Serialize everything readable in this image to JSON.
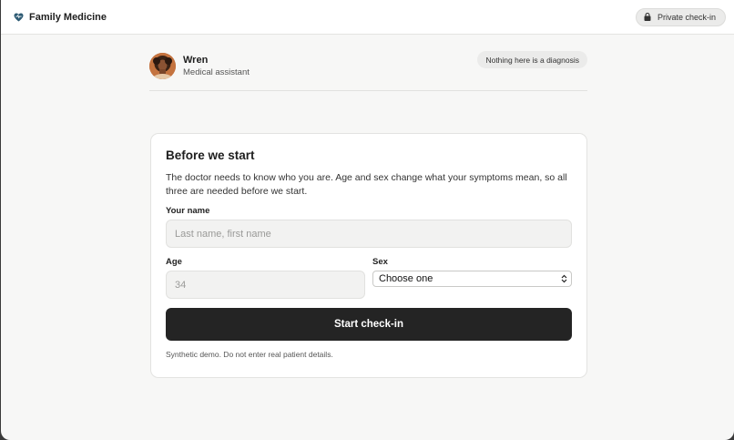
{
  "header": {
    "brand_name": "Family Medicine",
    "private_label": "Private check-in",
    "brand_color": "#2d5a73"
  },
  "assistant": {
    "name": "Wren",
    "role": "Medical assistant",
    "notice": "Nothing here is a diagnosis"
  },
  "form": {
    "title": "Before we start",
    "description": "The doctor needs to know who you are. Age and sex change what your symptoms mean, so all three are needed before we start.",
    "name_label": "Your name",
    "name_placeholder": "Last name, first name",
    "age_label": "Age",
    "age_placeholder": "34",
    "sex_label": "Sex",
    "sex_selected": "Choose one",
    "submit_label": "Start check-in",
    "footnote": "Synthetic demo. Do not enter real patient details."
  }
}
